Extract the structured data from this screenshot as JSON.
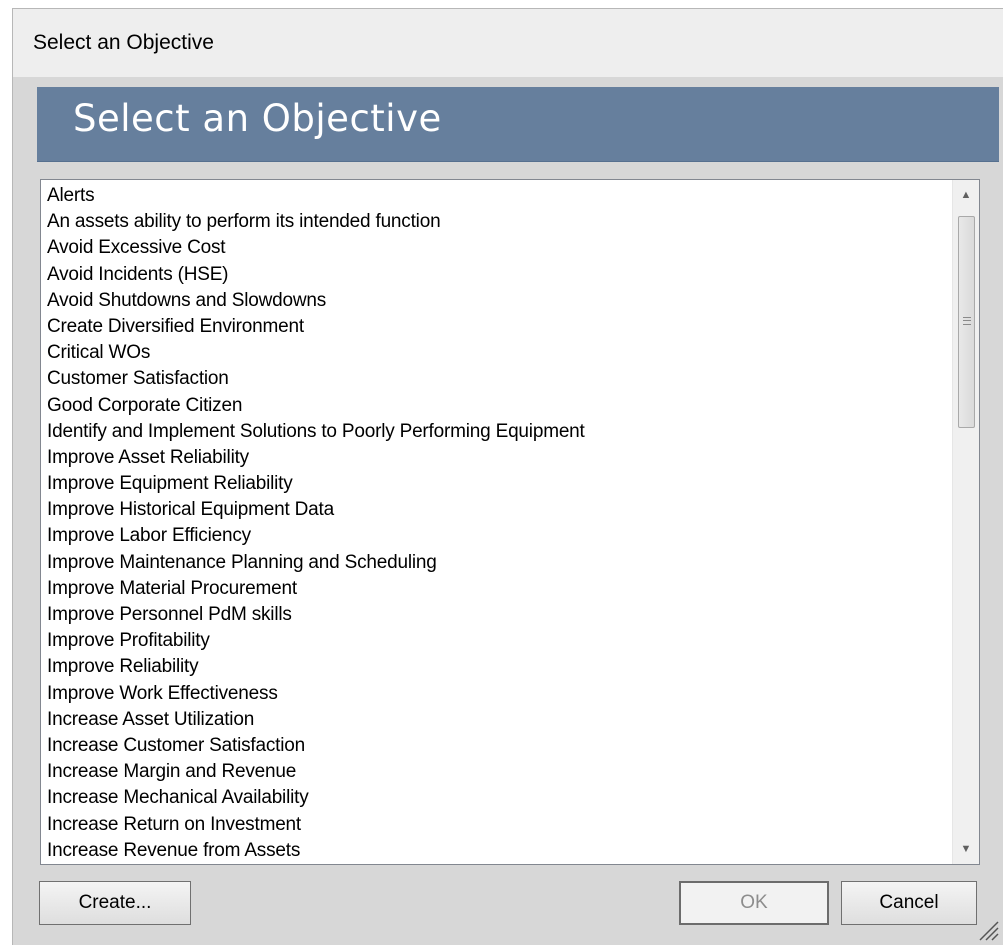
{
  "window": {
    "title": "Select an Objective"
  },
  "banner": {
    "heading": "Select an Objective"
  },
  "objectives": [
    "Alerts",
    "An assets ability to perform its intended function",
    "Avoid Excessive Cost",
    "Avoid Incidents (HSE)",
    "Avoid Shutdowns and Slowdowns",
    "Create Diversified Environment",
    "Critical WOs",
    "Customer Satisfaction",
    "Good Corporate Citizen",
    "Identify and Implement Solutions to Poorly Performing Equipment",
    "Improve Asset Reliability",
    "Improve Equipment Reliability",
    "Improve Historical Equipment Data",
    "Improve Labor Efficiency",
    "Improve Maintenance Planning and Scheduling",
    "Improve Material Procurement",
    "Improve Personnel PdM skills",
    "Improve Profitability",
    "Improve Reliability",
    "Improve Work Effectiveness",
    "Increase Asset Utilization",
    "Increase Customer Satisfaction",
    "Increase Margin and Revenue",
    "Increase Mechanical Availability",
    "Increase Return on Investment",
    "Increase Revenue from Assets"
  ],
  "buttons": {
    "create": "Create...",
    "ok": "OK",
    "cancel": "Cancel"
  },
  "icons": {
    "scroll_up": "chevron-up-icon",
    "scroll_down": "chevron-down-icon",
    "resize": "resize-grip-icon"
  },
  "colors": {
    "banner": "#667f9d",
    "body": "#d7d7d7"
  }
}
